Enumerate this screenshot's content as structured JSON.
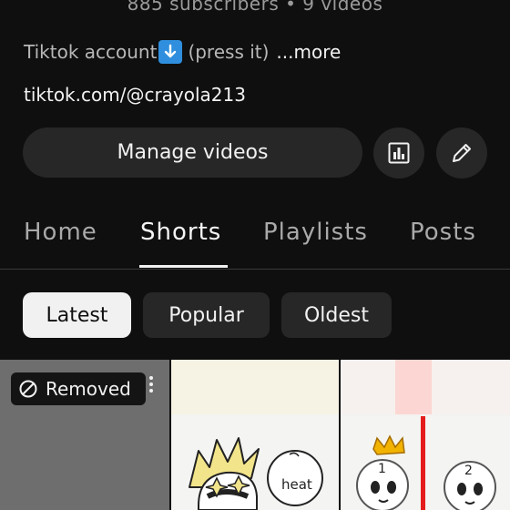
{
  "channel": {
    "subscriber_line": "885 subscribers • 9 videos",
    "description": "Tiktok account",
    "description_note": "(press it)",
    "more_label": "...more",
    "link": "tiktok.com/@crayola213"
  },
  "actions": {
    "manage_label": "Manage videos"
  },
  "tabs": [
    {
      "label": "Home"
    },
    {
      "label": "Shorts"
    },
    {
      "label": "Playlists"
    },
    {
      "label": "Posts"
    }
  ],
  "active_tab": "Shorts",
  "filters": [
    {
      "label": "Latest"
    },
    {
      "label": "Popular"
    },
    {
      "label": "Oldest"
    }
  ],
  "active_filter": "Latest",
  "shorts": [
    {
      "status": "Removed"
    },
    {
      "drawing_text": "heat"
    },
    {
      "drawing_labels": [
        "1",
        "2"
      ]
    }
  ],
  "colors": {
    "background": "#0f0f0f",
    "button_bg": "#272727",
    "arrow_badge": "#2f8fde",
    "crown": "#f2b200"
  }
}
